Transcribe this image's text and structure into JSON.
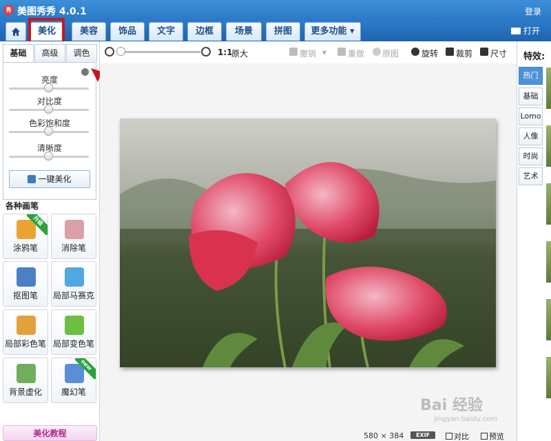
{
  "app": {
    "logo": "秀",
    "title": "美图秀秀 4.0.1",
    "login": "登录"
  },
  "nav": {
    "tabs": [
      {
        "label": "美化",
        "active": true
      },
      {
        "label": "美容"
      },
      {
        "label": "饰品"
      },
      {
        "label": "文字"
      },
      {
        "label": "边框"
      },
      {
        "label": "场景"
      },
      {
        "label": "拼图"
      },
      {
        "label": "更多功能 ▾"
      }
    ],
    "open": "打开",
    "home_icon": "home-icon"
  },
  "left": {
    "sub_tabs": [
      {
        "label": "基础",
        "active": true
      },
      {
        "label": "高级"
      },
      {
        "label": "调色"
      }
    ],
    "sliders": [
      {
        "label": "亮度",
        "value": 0.5
      },
      {
        "label": "对比度",
        "value": 0.5
      },
      {
        "label": "色彩饱和度",
        "value": 0.5
      },
      {
        "label": "清晰度",
        "value": 0.5
      }
    ],
    "one_key": "一键美化",
    "brush_heading": "各种画笔",
    "brushes": [
      {
        "label": "涂鸦笔",
        "badge": "升级",
        "icon": "pencil-icon",
        "color": "#e9a534"
      },
      {
        "label": "消除笔",
        "badge": "",
        "icon": "eraser-icon",
        "color": "#d9a0a8"
      },
      {
        "label": "抠图笔",
        "badge": "",
        "icon": "pen-nib-icon",
        "color": "#4d7fc6"
      },
      {
        "label": "局部马赛克",
        "badge": "",
        "icon": "mosaic-icon",
        "color": "#4fa8e0"
      },
      {
        "label": "局部彩色笔",
        "badge": "",
        "icon": "paintbrush-icon",
        "color": "#e3a13c"
      },
      {
        "label": "局部变色笔",
        "badge": "",
        "icon": "bucket-icon",
        "color": "#6cbf43"
      },
      {
        "label": "背景虚化",
        "badge": "",
        "icon": "blur-icon",
        "color": "#6fae5a"
      },
      {
        "label": "魔幻笔",
        "badge": "new",
        "icon": "magic-wand-icon",
        "color": "#5a8fd8"
      }
    ],
    "tutorial": "美化教程"
  },
  "toolbar": {
    "zoom_value": 0.0,
    "ratio": "1:1",
    "original_size": "原大",
    "undo": "撤销",
    "redo": "重做",
    "original": "原图",
    "rotate": "旋转",
    "crop": "裁剪",
    "size": "尺寸"
  },
  "status": {
    "width": "580",
    "times": "×",
    "height": "384",
    "exif": "EXIF",
    "compare": "对比",
    "preview": "预览"
  },
  "right": {
    "title": "特效:",
    "tabs": [
      {
        "label": "热门",
        "active": true
      },
      {
        "label": "基础"
      },
      {
        "label": "Lomo"
      },
      {
        "label": "人像"
      },
      {
        "label": "时尚"
      },
      {
        "label": "艺术"
      }
    ]
  },
  "watermark": {
    "text": "Bai 经验",
    "url": "jingyan.baidu.com"
  },
  "colors": {
    "accent": "#2a78c6",
    "highlight": "#c8171e",
    "badge_green": "#29a33b",
    "tutorial": "#b3268f"
  }
}
